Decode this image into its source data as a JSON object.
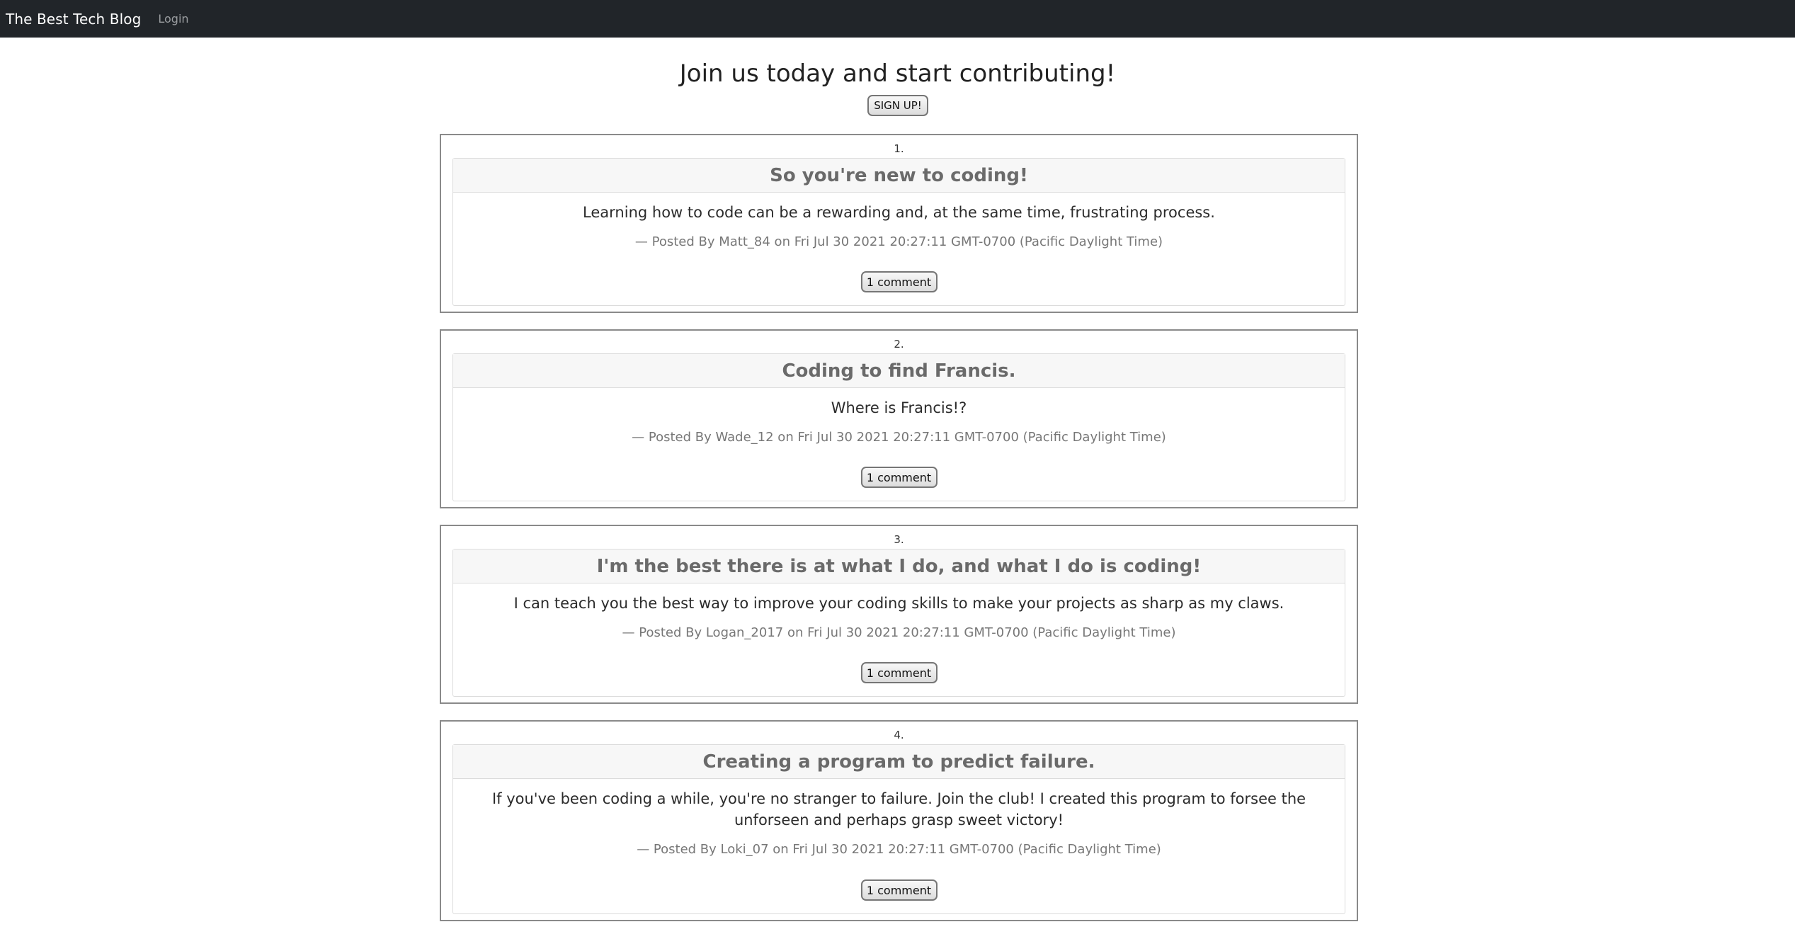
{
  "navbar": {
    "brand": "The Best Tech Blog",
    "login_label": "Login"
  },
  "hero": {
    "title": "Join us today and start contributing!",
    "signup_label": "SIGN UP!"
  },
  "posts": [
    {
      "number": "1.",
      "title": "So you're new to coding!",
      "body": "Learning how to code can be a rewarding and, at the same time, frustrating process.",
      "meta": "— Posted By Matt_84 on Fri Jul 30 2021 20:27:11 GMT-0700 (Pacific Daylight Time)",
      "comments_label": "1 comment"
    },
    {
      "number": "2.",
      "title": "Coding to find Francis.",
      "body": "Where is Francis!?",
      "meta": "— Posted By Wade_12 on Fri Jul 30 2021 20:27:11 GMT-0700 (Pacific Daylight Time)",
      "comments_label": "1 comment"
    },
    {
      "number": "3.",
      "title": "I'm the best there is at what I do, and what I do is coding!",
      "body": "I can teach you the best way to improve your coding skills to make your projects as sharp as my claws.",
      "meta": "— Posted By Logan_2017 on Fri Jul 30 2021 20:27:11 GMT-0700 (Pacific Daylight Time)",
      "comments_label": "1 comment"
    },
    {
      "number": "4.",
      "title": "Creating a program to predict failure.",
      "body": "If you've been coding a while, you're no stranger to failure. Join the club! I created this program to forsee the unforseen and perhaps grasp sweet victory!",
      "meta": "— Posted By Loki_07 on Fri Jul 30 2021 20:27:11 GMT-0700 (Pacific Daylight Time)",
      "comments_label": "1 comment"
    }
  ]
}
